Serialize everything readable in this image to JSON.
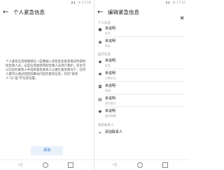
{
  "left": {
    "title": "个人紧急信息",
    "description": "个人紧急信息将能够在一些数据入手后发生紧急情况时提供给急救人员，这些信息能够帮助急救人员进行救护。您也可以在您的联系人中选择紧急联系人以便在紧急情况下，任何人都可以通过锁定屏幕访问您的紧急信息，包括“联系人”与“医”疗信息设置。",
    "add_button": "添加"
  },
  "right": {
    "title": "编辑紧急信息",
    "sections": {
      "personal": "个人信息",
      "medical": "医疗信息",
      "contacts": "紧急联系人"
    },
    "name": {
      "value": "未说明",
      "sub": "姓名"
    },
    "address": {
      "value": "未说明",
      "sub": "地址"
    },
    "medical_items": [
      {
        "value": "未说明",
        "sub": "血型"
      },
      {
        "value": "未说明",
        "sub": "过敏反应"
      },
      {
        "value": "未说明",
        "sub": "药物"
      },
      {
        "value": "未说明",
        "sub": "医疗备注"
      },
      {
        "value": "未说明",
        "sub": "器官捐献"
      }
    ],
    "add_contact": "添加联系人"
  },
  "status_time": "17:10",
  "icons": {
    "back": "arrow-left-icon",
    "save": "save-icon",
    "person": "person-icon",
    "location": "location-pin-icon",
    "medical": "medical-icon",
    "add": "plus-icon"
  }
}
